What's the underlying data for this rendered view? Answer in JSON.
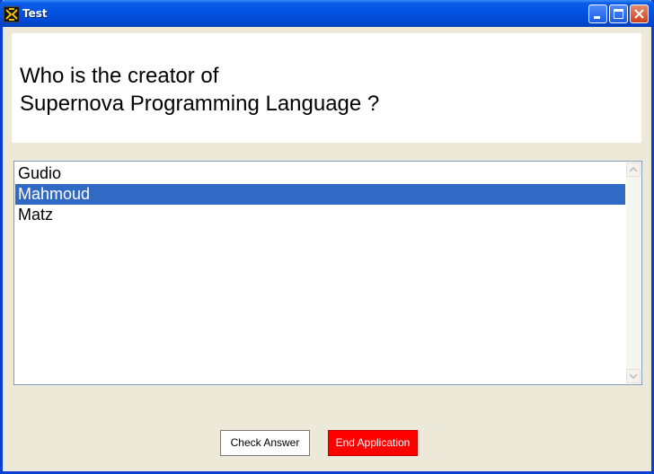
{
  "window": {
    "title": "Test",
    "icon": "app-icon",
    "controls": [
      "minimize-icon",
      "maximize-icon",
      "close-icon"
    ]
  },
  "question": {
    "line1": "Who is the creator of",
    "line2": "Supernova Programming Language ?"
  },
  "answers": {
    "items": [
      {
        "label": "Gudio",
        "selected": false
      },
      {
        "label": "Mahmoud",
        "selected": true
      },
      {
        "label": "Matz",
        "selected": false
      }
    ]
  },
  "buttons": {
    "check_label": "Check Answer",
    "end_label": "End Application",
    "end_color": "#ff0000"
  },
  "colors": {
    "titlebar": "#0354e3",
    "selection": "#316ac5",
    "background": "#ECE9D8"
  }
}
